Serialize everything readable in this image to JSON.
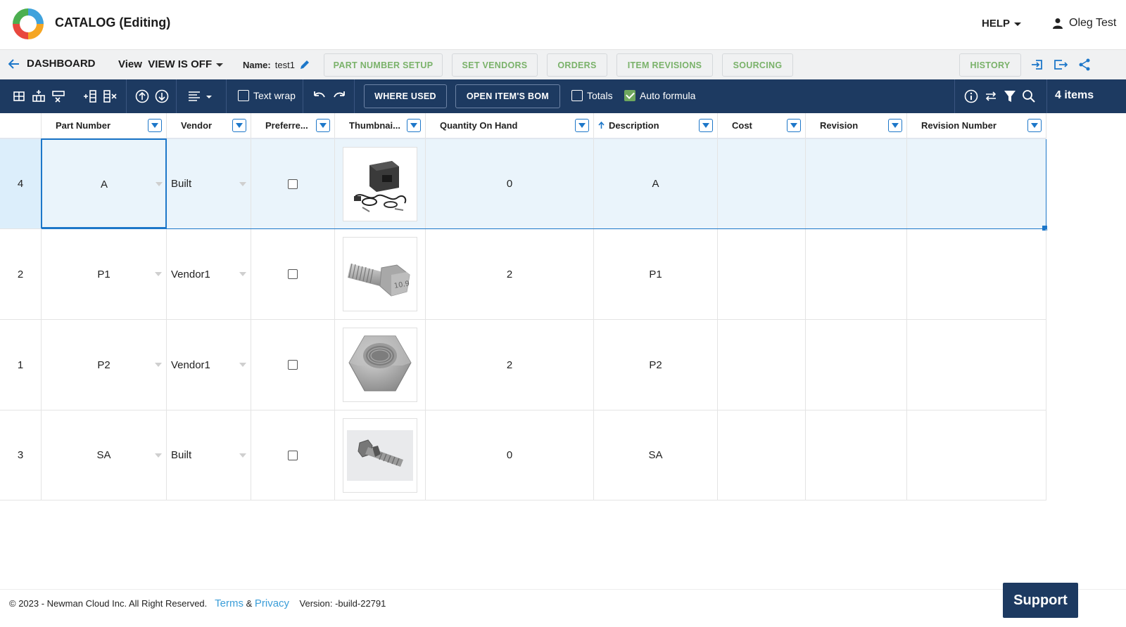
{
  "header": {
    "app_title": "CATALOG (Editing)",
    "help_label": "HELP",
    "user_name": "Oleg Test"
  },
  "nav": {
    "back_label": "DASHBOARD",
    "view_label": "View",
    "view_value": "VIEW IS OFF",
    "name_label": "Name:",
    "name_value": "test1",
    "buttons": [
      "PART NUMBER SETUP",
      "SET VENDORS",
      "ORDERS",
      "ITEM REVISIONS",
      "SOURCING"
    ],
    "history_label": "HISTORY"
  },
  "toolbar": {
    "text_wrap_label": "Text wrap",
    "where_used_label": "WHERE USED",
    "open_bom_label": "OPEN ITEM'S BOM",
    "totals_label": "Totals",
    "auto_formula_label": "Auto formula",
    "items_count": "4 items"
  },
  "table": {
    "columns": [
      "Part Number",
      "Vendor",
      "Preferre...",
      "Thumbnai...",
      "Quantity On Hand",
      "Description",
      "Cost",
      "Revision",
      "Revision Number"
    ],
    "rows": [
      {
        "num": "4",
        "part": "A",
        "vendor": "Built",
        "preferred": false,
        "thumb": "welder-kit",
        "qty": "0",
        "desc": "A",
        "cost": "",
        "rev": "",
        "revnum": ""
      },
      {
        "num": "2",
        "part": "P1",
        "vendor": "Vendor1",
        "preferred": false,
        "thumb": "hex-bolt",
        "qty": "2",
        "desc": "P1",
        "cost": "",
        "rev": "",
        "revnum": ""
      },
      {
        "num": "1",
        "part": "P2",
        "vendor": "Vendor1",
        "preferred": false,
        "thumb": "hex-nut",
        "qty": "2",
        "desc": "P2",
        "cost": "",
        "rev": "",
        "revnum": ""
      },
      {
        "num": "3",
        "part": "SA",
        "vendor": "Built",
        "preferred": false,
        "thumb": "bolt-assembly",
        "qty": "0",
        "desc": "SA",
        "cost": "",
        "rev": "",
        "revnum": ""
      }
    ],
    "bolt_marking": "10.9"
  },
  "footer": {
    "copyright": "© 2023 - Newman Cloud Inc. All Right Reserved.",
    "terms": "Terms",
    "amp": "&",
    "privacy": "Privacy",
    "version": "Version: -build-22791"
  },
  "support_label": "Support",
  "colors": {
    "toolbar_bg": "#1d3a61",
    "accent_green": "#7ab26a",
    "accent_blue": "#1d77c9"
  }
}
